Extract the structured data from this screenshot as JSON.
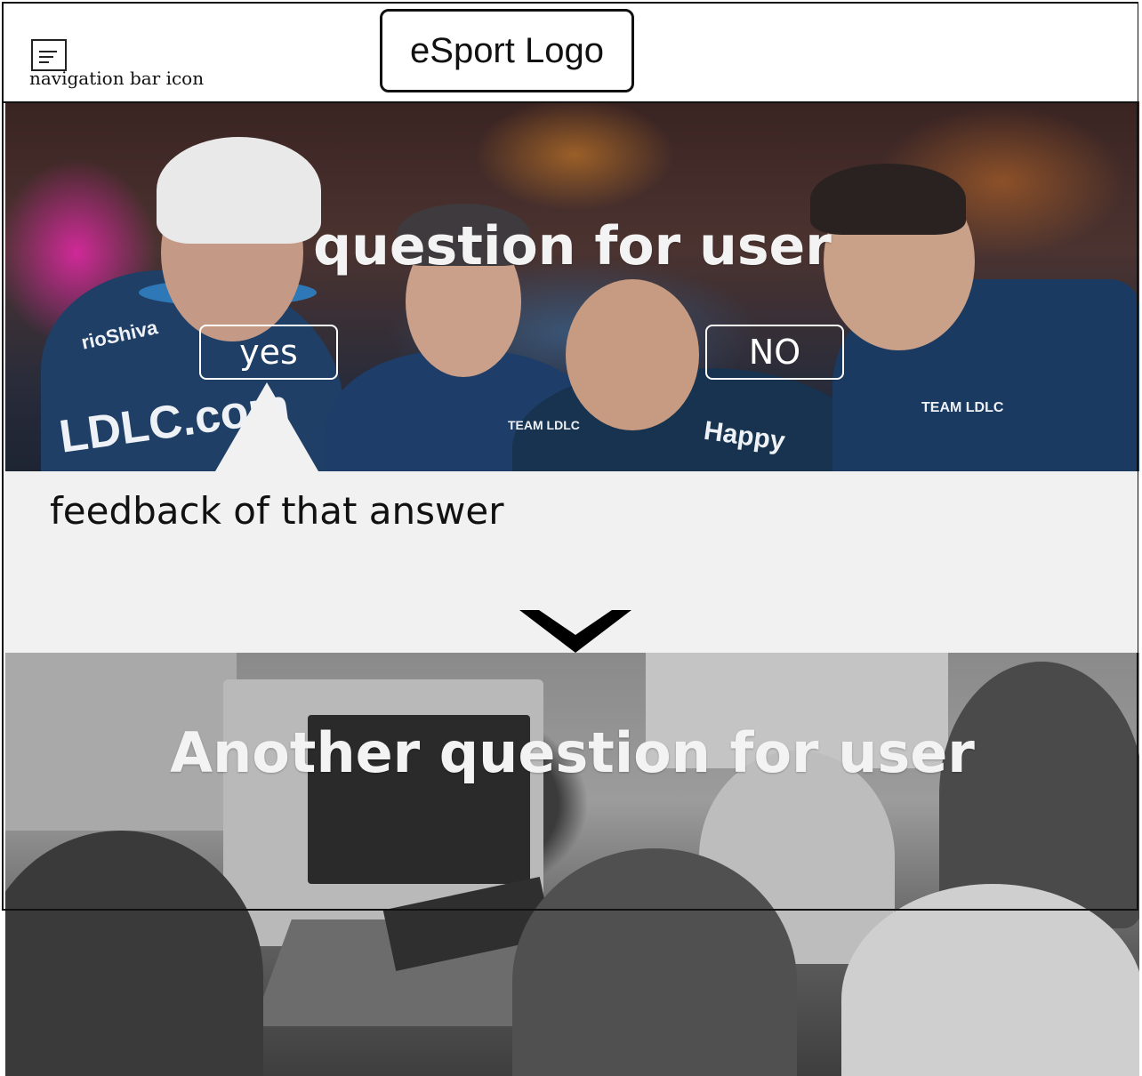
{
  "header": {
    "nav_icon_caption": "navigation bar icon",
    "logo_text": "eSport Logo"
  },
  "hero1": {
    "question": "question for user",
    "answers": {
      "yes": "yes",
      "no": "NO"
    },
    "jersey_texts": [
      "rioShiva",
      "LDLC.com",
      "Happy",
      "TEAM LDLC",
      "TEAM LDLC"
    ]
  },
  "feedback": {
    "text": "feedback of that answer",
    "icon": "chevron-down-icon"
  },
  "hero2": {
    "question": "Another question for user"
  },
  "colors": {
    "feedback_background": "#f1f1f1",
    "title_text": "#f3f3f3",
    "frame": "#111111"
  }
}
